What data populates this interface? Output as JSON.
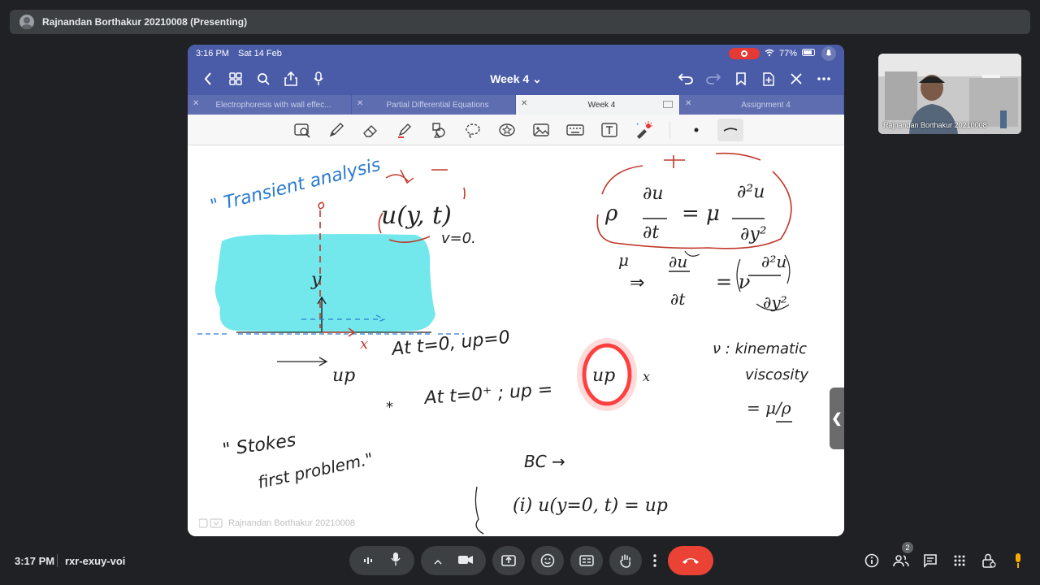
{
  "presenting_bar": {
    "label": "Rajnandan Borthakur 20210008 (Presenting)"
  },
  "ipad": {
    "status": {
      "time": "3:16 PM",
      "date": "Sat 14 Feb",
      "battery": "77%"
    },
    "nav": {
      "title": "Week 4 ⌄"
    },
    "tabs": [
      {
        "label": "Electrophoresis with wall effec...",
        "active": false
      },
      {
        "label": "Partial Differential Equations",
        "active": false
      },
      {
        "label": "Week 4",
        "active": true
      },
      {
        "label": "Assignment 4",
        "active": false
      }
    ],
    "notes": {
      "transient": "\" Transient analysis",
      "u_yt": "u(y, t)",
      "v0": "v=0.",
      "y": "y",
      "x": "x",
      "at_t0": "At t=0, up=0",
      "at_t0plus": "At t=0⁺ ; up =",
      "up0": "up",
      "star": "*",
      "stokes1": "\" Stokes",
      "stokes2": "first problem.\"",
      "bc": "BC →",
      "bc1": "(i) u(y=0, t) = up",
      "rho": "ρ",
      "du": "∂u",
      "dt": "∂t",
      "eq1": "= μ",
      "d2u": "∂²u",
      "dy2": "∂y²",
      "implies": "⇒",
      "eq2": "= ν",
      "kin1": "ν : kinematic",
      "kin2": "viscosity",
      "kin3": "= μ/ρ",
      "plus": "+",
      "mu_hand": "μ"
    },
    "watermark": "Rajnandan Borthakur 20210008"
  },
  "self_tile": {
    "name": "Rajnandan Borthakur 20210008"
  },
  "bottom_bar": {
    "time": "3:17 PM",
    "meeting_code": "rxr-exuy-voi",
    "participant_count": "2"
  },
  "colors": {
    "meet_bg": "#202124",
    "ipad_header": "#4a5ba8",
    "highlight_cyan": "#72e8ec",
    "ink_red": "#c0392b",
    "ink_blue": "#2a7bd0",
    "hangup_red": "#ea4335"
  }
}
